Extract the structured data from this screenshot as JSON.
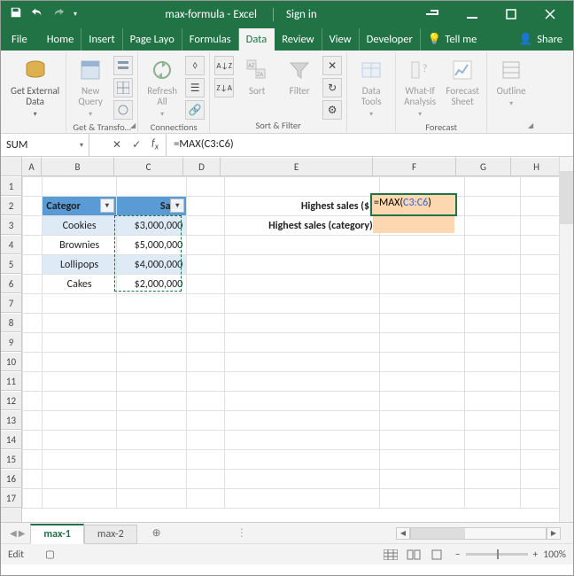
{
  "window": {
    "doc": "max-formula",
    "app": "Excel",
    "signin": "Sign in"
  },
  "tabs": {
    "file": "File",
    "home": "Home",
    "insert": "Insert",
    "pagelayout": "Page Layo",
    "formulas": "Formulas",
    "data": "Data",
    "review": "Review",
    "view": "View",
    "developer": "Developer",
    "tellme": "Tell me",
    "share": "Share"
  },
  "ribbon": {
    "getdata": "Get External\nData",
    "newquery": "New\nQuery",
    "gettransform": "Get & Transfo…",
    "refresh": "Refresh\nAll",
    "connections": "Connections",
    "sort": "Sort",
    "filter": "Filter",
    "sortfilter": "Sort & Filter",
    "datatools": "Data\nTools",
    "whatif": "What-If\nAnalysis",
    "forecastsheet": "Forecast\nSheet",
    "forecast": "Forecast",
    "outline": "Outline"
  },
  "formula_bar": {
    "name": "SUM",
    "formula": "=MAX(C3:C6)"
  },
  "grid": {
    "columns": [
      "A",
      "B",
      "C",
      "D",
      "E",
      "F",
      "G",
      "H"
    ],
    "widths": [
      22,
      82,
      78,
      42,
      172,
      94,
      62,
      58
    ],
    "tbl_headers": {
      "b": "Categor",
      "c": "Sales"
    },
    "tbl_rows": [
      {
        "b": "Cookies",
        "c": "$3,000,000"
      },
      {
        "b": "Brownies",
        "c": "$5,000,000"
      },
      {
        "b": "Lollipops",
        "c": "$4,000,000"
      },
      {
        "b": "Cakes",
        "c": "$2,000,000"
      }
    ],
    "labels": {
      "e2": "Highest sales ($):",
      "e3": "Highest sales (category):"
    },
    "editing": {
      "display_prefix": "=MAX(",
      "display_range": "C3:C6",
      "display_suffix": ")"
    }
  },
  "sheets": {
    "s1": "max-1",
    "s2": "max-2"
  },
  "status": {
    "mode": "Edit",
    "zoom": "100%"
  }
}
